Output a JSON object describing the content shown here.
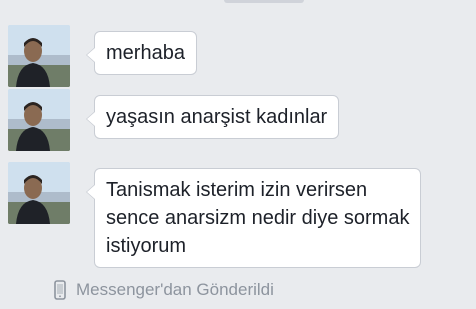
{
  "messages": [
    {
      "lines": [
        "merhaba"
      ]
    },
    {
      "lines": [
        "yaşasın anarşist kadınlar"
      ]
    },
    {
      "lines": [
        "Tanismak isterim izin verirsen",
        "sence anarsizm nedir diye sormak",
        "istiyorum"
      ]
    }
  ],
  "footer": {
    "icon": "mobile-phone-icon",
    "label": "Messenger'dan Gönderildi"
  },
  "colors": {
    "background": "#e9ebee",
    "bubble": "#ffffff",
    "bubble_border": "#c9cdd4",
    "text": "#1d2129",
    "meta_text": "#8d949e"
  }
}
